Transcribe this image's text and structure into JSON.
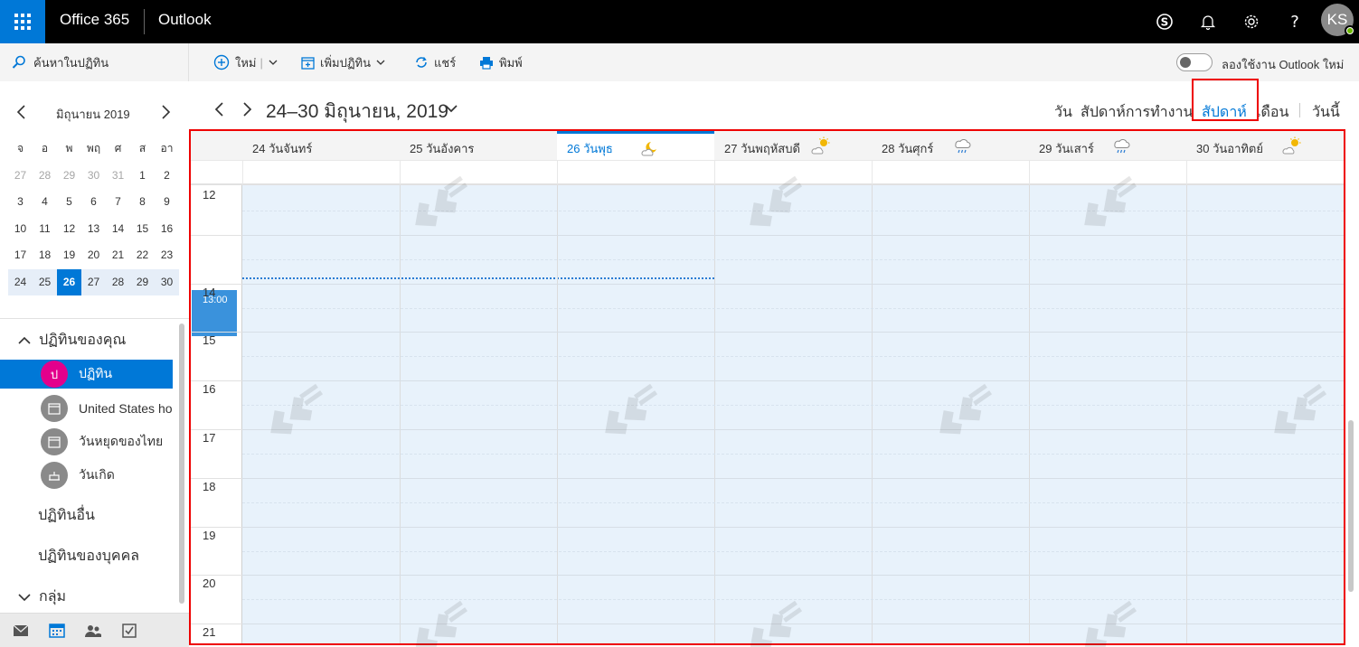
{
  "topbar": {
    "brand": "Office 365",
    "app": "Outlook",
    "avatar_initials": "KS",
    "icons": [
      "app-launcher-icon",
      "skype-icon",
      "bell-icon",
      "gear-icon",
      "help-icon"
    ]
  },
  "command_bar": {
    "search_placeholder": "ค้นหาในปฏิทิน",
    "new_label": "ใหม่",
    "add_calendar_label": "เพิ่มปฏิทิน",
    "share_label": "แชร์",
    "print_label": "พิมพ์",
    "toggle_label": "ลองใช้งาน Outlook ใหม่",
    "toggle_on": false
  },
  "mini_calendar": {
    "title": "มิถุนายน 2019",
    "weekdays": [
      "จ",
      "อ",
      "พ",
      "พฤ",
      "ศ",
      "ส",
      "อา"
    ],
    "weeks": [
      [
        "27",
        "28",
        "29",
        "30",
        "31",
        "1",
        "2"
      ],
      [
        "3",
        "4",
        "5",
        "6",
        "7",
        "8",
        "9"
      ],
      [
        "10",
        "11",
        "12",
        "13",
        "14",
        "15",
        "16"
      ],
      [
        "17",
        "18",
        "19",
        "20",
        "21",
        "22",
        "23"
      ],
      [
        "24",
        "25",
        "26",
        "27",
        "28",
        "29",
        "30"
      ]
    ],
    "today": "26"
  },
  "sidebar": {
    "your_calendars_label": "ปฏิทินของคุณ",
    "calendars": [
      {
        "label": "ปฏิทิน",
        "badge": "ป",
        "color": "#e3008c",
        "selected": true
      },
      {
        "label": "United States holi",
        "color": "#8a8a8a",
        "selected": false
      },
      {
        "label": "วันหยุดของไทย",
        "color": "#8a8a8a",
        "selected": false
      },
      {
        "label": "วันเกิด",
        "color": "#8a8a8a",
        "selected": false
      }
    ],
    "other_calendars_label": "ปฏิทินอื่น",
    "people_calendars_label": "ปฏิทินของบุคคล",
    "groups_label": "กลุ่ม"
  },
  "range": {
    "title": "24–30 มิถุนายน, 2019"
  },
  "views": {
    "day": "วัน",
    "work_week": "สัปดาห์การทำงาน",
    "week": "สัปดาห์",
    "month": "เดือน",
    "today": "วันนี้",
    "active": "week"
  },
  "days": [
    {
      "label": "24 วันจันทร์",
      "weather": ""
    },
    {
      "label": "25 วันอังคาร",
      "weather": ""
    },
    {
      "label": "26 วันพุธ",
      "weather": "moon-cloud-icon",
      "today": true
    },
    {
      "label": "27 วันพฤหัสบดี",
      "weather": "sun-cloud-icon"
    },
    {
      "label": "28 วันศุกร์",
      "weather": "rain-icon"
    },
    {
      "label": "29 วันเสาร์",
      "weather": "rain-icon"
    },
    {
      "label": "30 วันอาทิตย์",
      "weather": "sun-cloud-icon"
    }
  ],
  "hours": [
    "12",
    "14",
    "15",
    "16",
    "17",
    "18",
    "19",
    "20",
    "21"
  ],
  "current_time": "13:00",
  "colors": {
    "accent": "#0078d7",
    "calendar_bg": "#e8f2fb",
    "highlight": "#e00000"
  }
}
